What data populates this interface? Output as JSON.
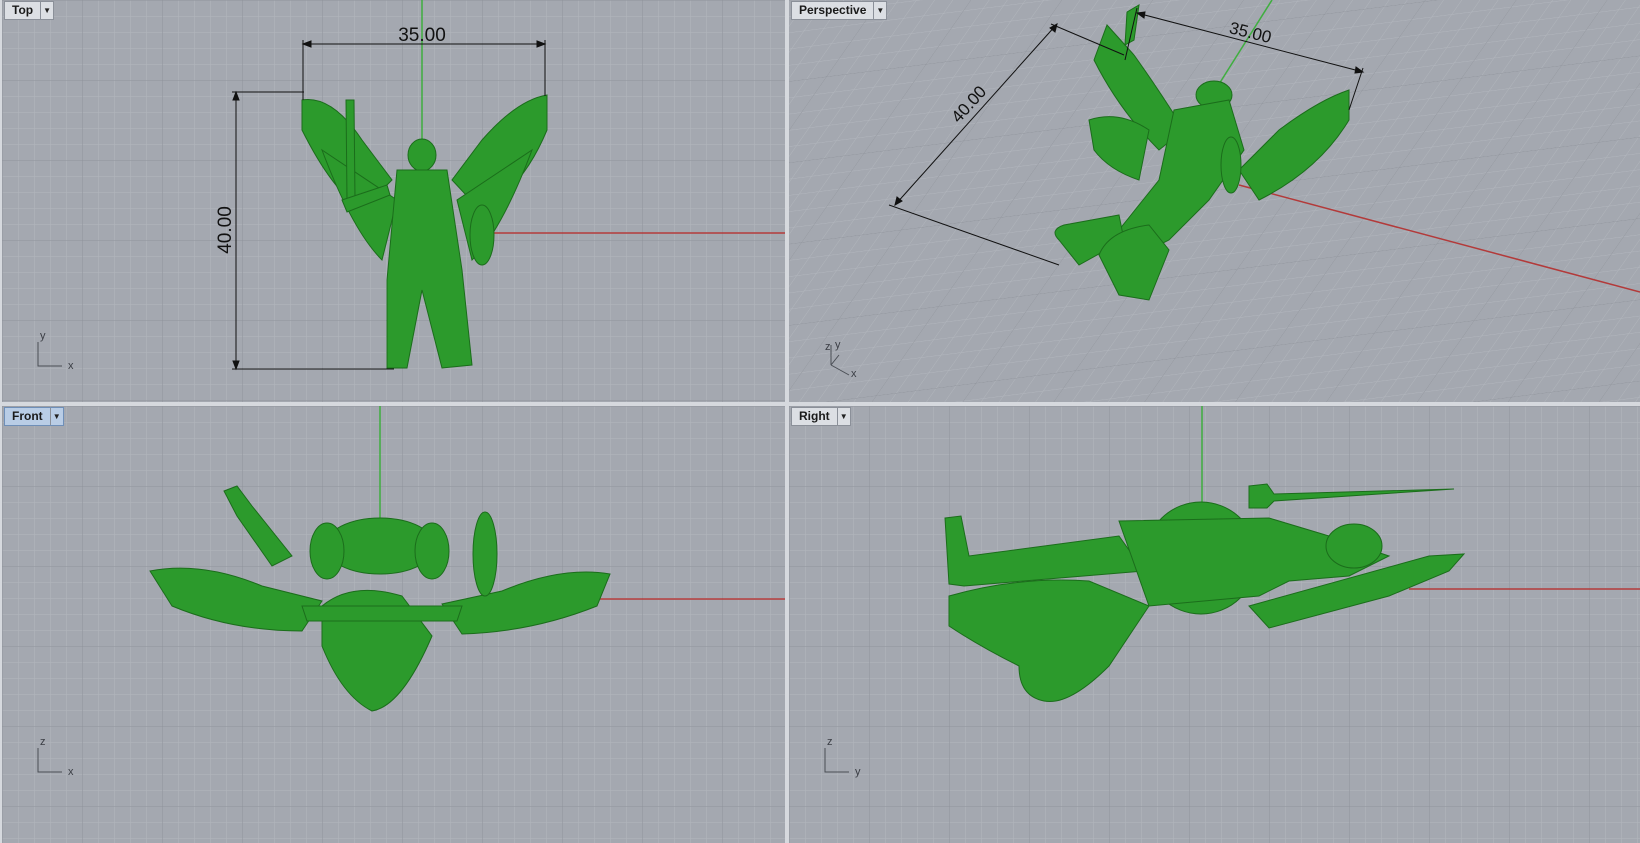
{
  "colors": {
    "viewport_bg": "#a4a8b0",
    "grid_minor": "#b3b7be",
    "grid_major": "#8f939b",
    "x_axis": "#b33a3a",
    "y_axis": "#3fae3f",
    "model": "#2c9a2c",
    "divider": "#d6d9de"
  },
  "viewports": {
    "top": {
      "label": "Top",
      "dim_horizontal": "35.00",
      "dim_vertical": "40.00",
      "axis_h": "x",
      "axis_v": "y"
    },
    "perspective": {
      "label": "Perspective",
      "dim_horizontal": "35.00",
      "dim_vertical": "40.00",
      "axis_z": "z",
      "axis_y": "y",
      "axis_x": "x"
    },
    "front": {
      "label": "Front",
      "axis_h": "x",
      "axis_v": "z"
    },
    "right": {
      "label": "Right",
      "axis_h": "y",
      "axis_v": "z"
    }
  },
  "icons": {
    "viewport_menu": "dropdown-arrow-icon",
    "axis_widget": "axis-icon"
  }
}
